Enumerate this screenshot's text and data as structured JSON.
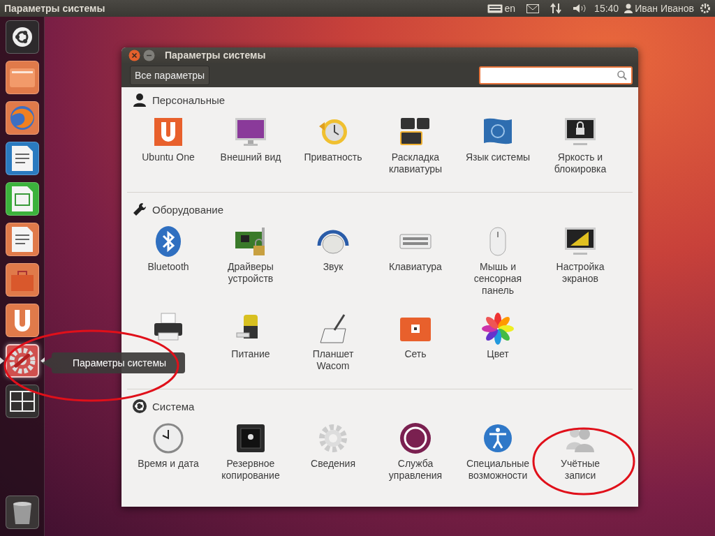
{
  "top_bar": {
    "title": "Параметры системы",
    "language": "en",
    "time": "15:40",
    "user": "Иван Иванов"
  },
  "launcher": {
    "items": [
      {
        "kind": "dash",
        "active": false
      },
      {
        "kind": "folder",
        "active": false
      },
      {
        "kind": "browser",
        "active": false
      },
      {
        "kind": "writer",
        "active": false
      },
      {
        "kind": "calc",
        "active": false
      },
      {
        "kind": "impress",
        "active": false
      },
      {
        "kind": "store",
        "active": false
      },
      {
        "kind": "cloud",
        "active": false
      },
      {
        "kind": "settings",
        "active": true
      },
      {
        "kind": "workspaces",
        "active": false
      }
    ],
    "trash": {
      "kind": "trash"
    }
  },
  "tooltip": "Параметры системы",
  "window": {
    "title": "Параметры системы",
    "all_settings_button": "Все параметры",
    "sections": [
      {
        "kind": "person",
        "title": "Персональные",
        "items": [
          {
            "kind": "u1",
            "label": "Ubuntu One"
          },
          {
            "kind": "appearance",
            "label": "Внешний вид"
          },
          {
            "kind": "privacy",
            "label": "Приватность"
          },
          {
            "kind": "layout",
            "label": "Раскладка клавиатуры"
          },
          {
            "kind": "language",
            "label": "Язык системы"
          },
          {
            "kind": "lock",
            "label": "Яркость и блокировка"
          }
        ]
      },
      {
        "kind": "wrench",
        "title": "Оборудование",
        "items": [
          {
            "kind": "bluetooth",
            "label": "Bluetooth"
          },
          {
            "kind": "drivers",
            "label": "Драйверы устройств"
          },
          {
            "kind": "sound",
            "label": "Звук"
          },
          {
            "kind": "keyboard",
            "label": "Клавиатура"
          },
          {
            "kind": "mouse",
            "label": "Мышь и сенсорная панель"
          },
          {
            "kind": "display",
            "label": "Настройка экранов"
          },
          {
            "kind": "printer"
          },
          {
            "kind": "power",
            "label": "Питание"
          },
          {
            "kind": "tablet",
            "label": "Планшет Wacom"
          },
          {
            "kind": "network",
            "label": "Сеть"
          },
          {
            "kind": "color",
            "label": "Цвет"
          }
        ]
      },
      {
        "kind": "ubuntu",
        "title": "Система",
        "items": [
          {
            "kind": "clock",
            "label": "Время и дата"
          },
          {
            "kind": "backup",
            "label": "Резервное копирование"
          },
          {
            "kind": "details",
            "label": "Сведения"
          },
          {
            "kind": "landscape",
            "label": "Служба управления"
          },
          {
            "kind": "access",
            "label": "Специальные возможности"
          },
          {
            "kind": "users",
            "label": "Учётные записи"
          }
        ]
      }
    ]
  },
  "annotations": [
    {
      "kind": "ellipse"
    },
    {
      "kind": "ellipse"
    }
  ]
}
